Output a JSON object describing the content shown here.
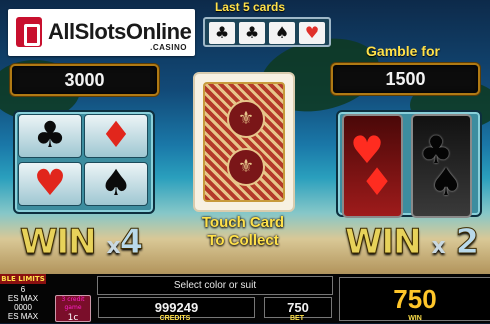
{
  "logo": {
    "text": "AllSlotsOnline",
    "sub": ".CASINO"
  },
  "last_cards": {
    "title": "Last 5 cards",
    "cards": [
      "♣",
      "♣",
      "♠",
      "♥"
    ]
  },
  "left_value": "3000",
  "gamble": {
    "title": "Gamble for",
    "value": "1500"
  },
  "suits": {
    "clubs": "♣",
    "diamonds": "♦",
    "hearts": "♥",
    "spades": "♠"
  },
  "color_cards": {
    "red_1": "♥",
    "red_2": "♦",
    "black_1": "♣",
    "black_2": "♠"
  },
  "touch_text": {
    "line1": "Touch Card",
    "line2": "To Collect"
  },
  "win_suit": {
    "win": "WIN",
    "x": "x",
    "mult": "4"
  },
  "win_color": {
    "win": "WIN",
    "x": "x",
    "mult": "2"
  },
  "bottom": {
    "limits_title": "BLE LIMITS",
    "limits_line1": "6",
    "limits_line2": "ES MAX",
    "limits_line3": "0000",
    "limits_line4": "ES MAX",
    "select_prompt": "Select color or suit",
    "help_top": "3 credit game",
    "help_bottom": "1c",
    "credits_value": "999249",
    "credits_label": "CREDITS",
    "bet_value": "750",
    "bet_label": "BET",
    "win_value": "750",
    "win_label": "WIN"
  }
}
